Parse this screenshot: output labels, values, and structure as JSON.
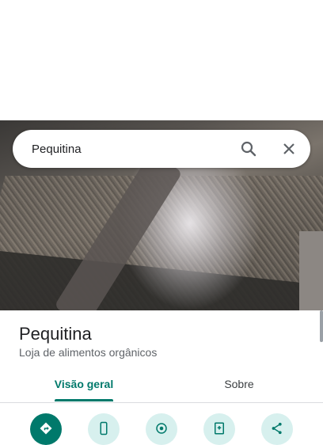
{
  "search": {
    "value": "Pequitina"
  },
  "place": {
    "name": "Pequitina",
    "category": "Loja de alimentos orgânicos"
  },
  "tabs": [
    {
      "label": "Visão geral",
      "active": true
    },
    {
      "label": "Sobre",
      "active": false
    }
  ],
  "actions": [
    {
      "icon": "directions-icon"
    },
    {
      "icon": "phone-icon"
    },
    {
      "icon": "location-icon"
    },
    {
      "icon": "save-icon"
    },
    {
      "icon": "share-icon"
    }
  ],
  "colors": {
    "accent": "#00796b",
    "action_bg": "#d7f0ee"
  }
}
